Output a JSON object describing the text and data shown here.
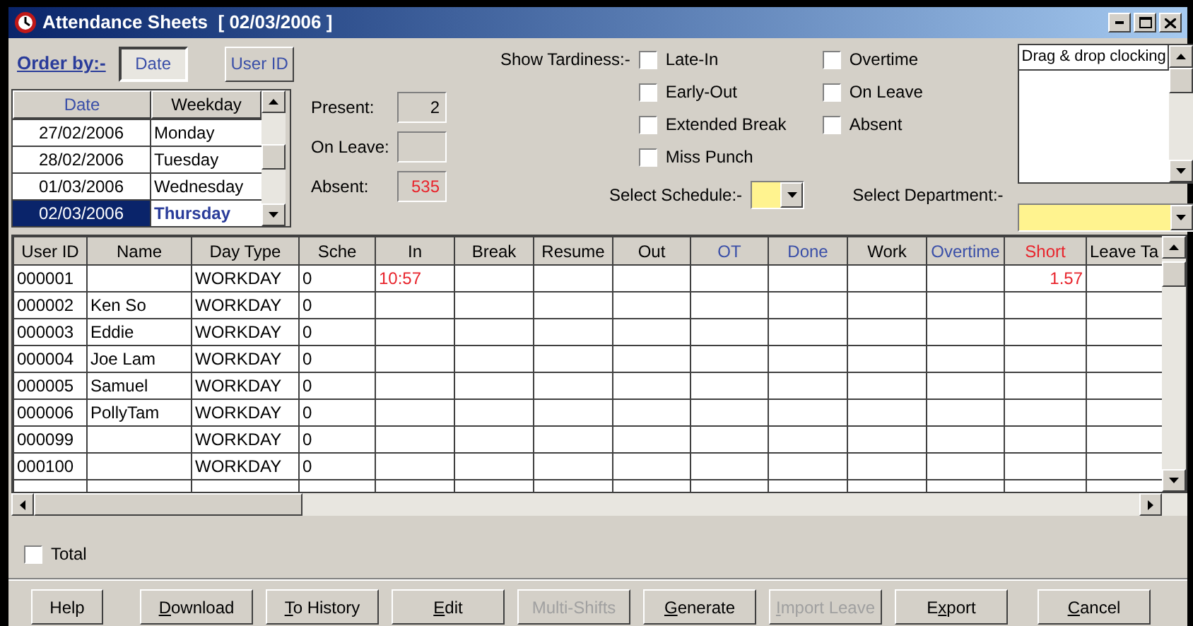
{
  "window": {
    "title": "Attendance Sheets  [ 02/03/2006 ]"
  },
  "order_by": {
    "label": "Order by:-",
    "buttons": [
      {
        "label": "Date",
        "selected": true
      },
      {
        "label": "User ID",
        "selected": false
      }
    ]
  },
  "date_list": {
    "columns": [
      {
        "label": "Date",
        "color": "#3a4fa8"
      },
      {
        "label": "Weekday",
        "color": "#000000"
      }
    ],
    "rows": [
      {
        "date": "27/02/2006",
        "weekday": "Monday",
        "selected": false
      },
      {
        "date": "28/02/2006",
        "weekday": "Tuesday",
        "selected": false
      },
      {
        "date": "01/03/2006",
        "weekday": "Wednesday",
        "selected": false
      },
      {
        "date": "02/03/2006",
        "weekday": "Thursday",
        "selected": true
      }
    ]
  },
  "counts": [
    {
      "label": "Present:",
      "value": "2",
      "color": "#000000"
    },
    {
      "label": "On Leave:"
    },
    {
      "label": "Absent:",
      "value": "535",
      "color": "#e8242c"
    }
  ],
  "tardiness": {
    "label": "Show Tardiness:-",
    "options": [
      {
        "label": "Late-In",
        "checked": false
      },
      {
        "label": "Early-Out",
        "checked": false
      },
      {
        "label": "Extended Break",
        "checked": false
      },
      {
        "label": "Miss Punch",
        "checked": false
      }
    ],
    "options_2": [
      {
        "label": "Overtime",
        "checked": false
      },
      {
        "label": "On Leave",
        "checked": false
      },
      {
        "label": "Absent",
        "checked": false
      }
    ]
  },
  "clocking_list": {
    "header": "Drag & drop clocking"
  },
  "select_schedule": {
    "label": "Select Schedule:-"
  },
  "select_department": {
    "label": "Select Department:-"
  },
  "table": {
    "columns": [
      {
        "label": "User ID",
        "color": "#000000"
      },
      {
        "label": "Name",
        "color": "#000000"
      },
      {
        "label": "Day Type",
        "color": "#000000"
      },
      {
        "label": "Sche",
        "color": "#000000"
      },
      {
        "label": "In",
        "color": "#000000"
      },
      {
        "label": "Break",
        "color": "#000000"
      },
      {
        "label": "Resume",
        "color": "#000000"
      },
      {
        "label": "Out",
        "color": "#000000"
      },
      {
        "label": "OT",
        "color": "#3a4fa8"
      },
      {
        "label": "Done",
        "color": "#3a4fa8"
      },
      {
        "label": "Work",
        "color": "#000000"
      },
      {
        "label": "Overtime",
        "color": "#3a4fa8"
      },
      {
        "label": "Short",
        "color": "#e8242c"
      },
      {
        "label": "Leave Ta",
        "color": "#000000"
      }
    ],
    "rows": [
      {
        "cells": [
          "000001",
          "",
          "WORKDAY",
          "0",
          "10:57",
          "",
          "",
          "",
          "",
          "",
          "",
          "",
          "1.57",
          ""
        ]
      },
      {
        "cells": [
          "000002",
          "Ken So",
          "WORKDAY",
          "0",
          "",
          "",
          "",
          "",
          "",
          "",
          "",
          "",
          "",
          ""
        ]
      },
      {
        "cells": [
          "000003",
          "Eddie",
          "WORKDAY",
          "0",
          "",
          "",
          "",
          "",
          "",
          "",
          "",
          "",
          "",
          ""
        ]
      },
      {
        "cells": [
          "000004",
          "Joe Lam",
          "WORKDAY",
          "0",
          "",
          "",
          "",
          "",
          "",
          "",
          "",
          "",
          "",
          ""
        ]
      },
      {
        "cells": [
          "000005",
          "Samuel",
          "WORKDAY",
          "0",
          "",
          "",
          "",
          "",
          "",
          "",
          "",
          "",
          "",
          ""
        ]
      },
      {
        "cells": [
          "000006",
          "PollyTam",
          "WORKDAY",
          "0",
          "",
          "",
          "",
          "",
          "",
          "",
          "",
          "",
          "",
          ""
        ]
      },
      {
        "cells": [
          "000099",
          "",
          "WORKDAY",
          "0",
          "",
          "",
          "",
          "",
          "",
          "",
          "",
          "",
          "",
          ""
        ]
      },
      {
        "cells": [
          "000100",
          "",
          "WORKDAY",
          "0",
          "",
          "",
          "",
          "",
          "",
          "",
          "",
          "",
          "",
          ""
        ]
      }
    ]
  },
  "total": {
    "label": "Total",
    "checked": false
  },
  "buttons": [
    {
      "before": "Help",
      "disabled": false
    },
    {
      "key": "D",
      "after": "ownload",
      "disabled": false
    },
    {
      "key": "T",
      "after": "o History",
      "disabled": false
    },
    {
      "key": "E",
      "after": "dit",
      "disabled": false
    },
    {
      "before": "Multi-Shifts",
      "disabled": true
    },
    {
      "key": "G",
      "after": "enerate",
      "disabled": false
    },
    {
      "key": "I",
      "after": "mport Leave",
      "disabled": true
    },
    {
      "before": "E",
      "key": "x",
      "after": "port",
      "disabled": false
    },
    {
      "key": "C",
      "after": "ancel",
      "disabled": false
    }
  ]
}
